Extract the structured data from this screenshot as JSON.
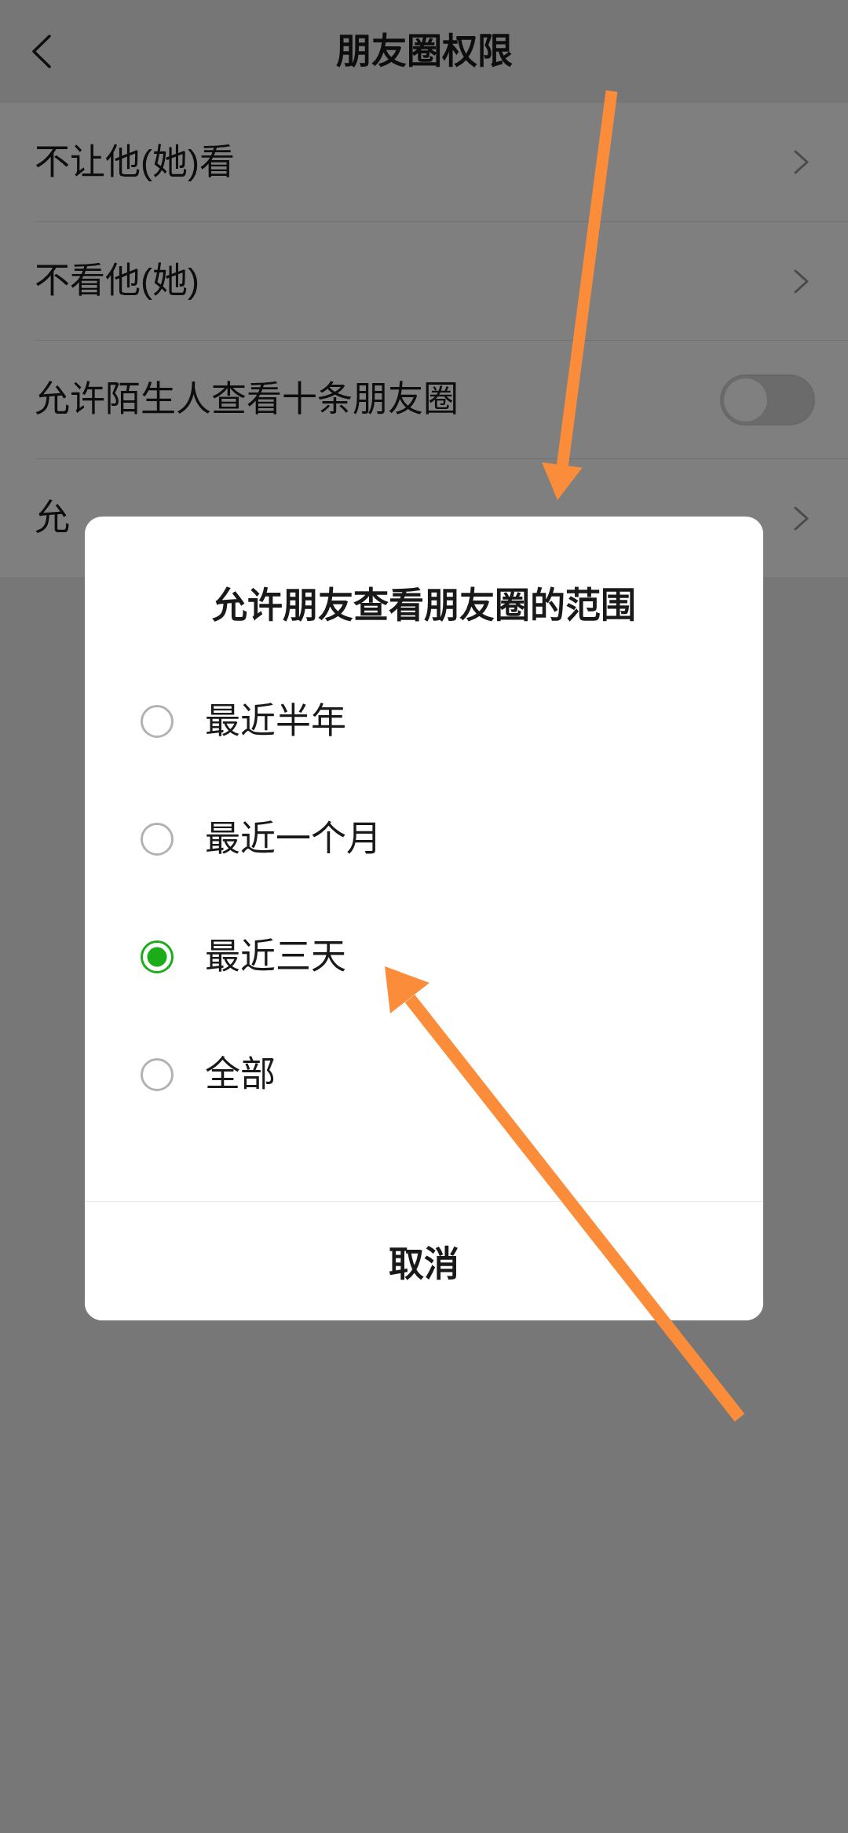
{
  "nav_bar": {
    "title": "朋友圈权限"
  },
  "settings": [
    {
      "kind": "link",
      "label": "不让他(她)看"
    },
    {
      "kind": "link",
      "label": "不看他(她)"
    },
    {
      "kind": "toggle",
      "label": "允许陌生人查看十条朋友圈",
      "on": false
    },
    {
      "kind": "link",
      "label": "允"
    }
  ],
  "dialog": {
    "title": "允许朋友查看朋友圈的范围",
    "options": [
      {
        "label": "最近半年",
        "selected": false
      },
      {
        "label": "最近一个月",
        "selected": false
      },
      {
        "label": "最近三天",
        "selected": true
      },
      {
        "label": "全部",
        "selected": false
      }
    ],
    "cancel": "取消"
  }
}
